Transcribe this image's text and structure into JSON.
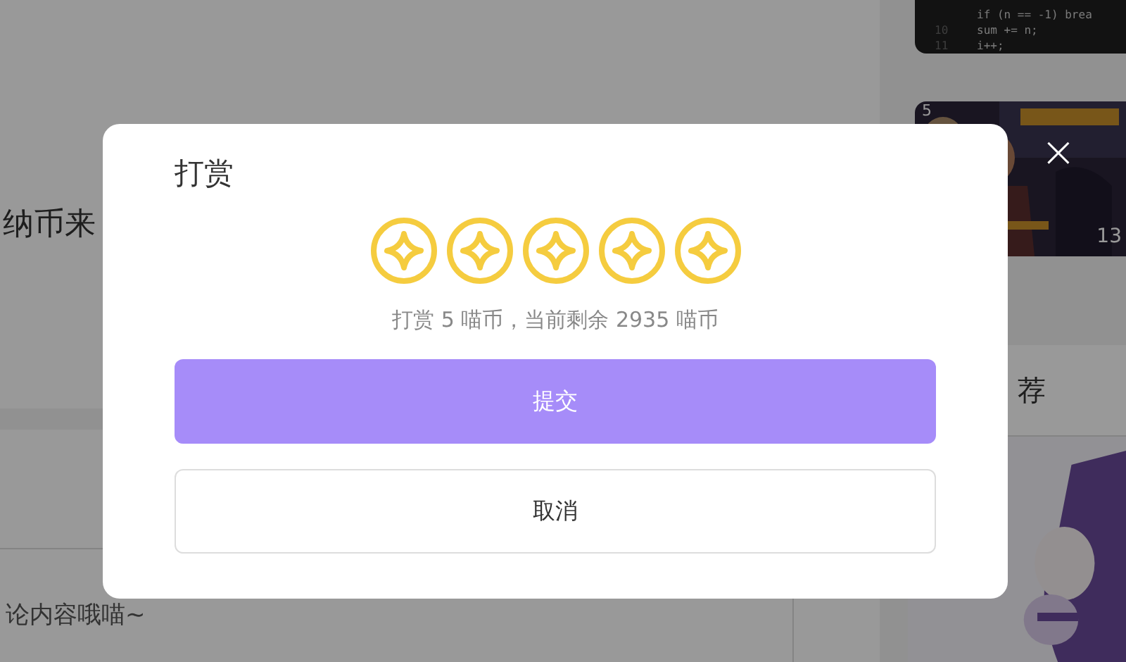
{
  "background": {
    "main_text": "纳币来",
    "comment_hint": "论内容哦喵~",
    "code_top": "if (n == -1) brea",
    "code_lines": [
      {
        "number": "10",
        "code": "sum += n;"
      },
      {
        "number": "11",
        "code": "i++;"
      }
    ],
    "video": {
      "kind": "picture",
      "index": "5",
      "duration": "13"
    },
    "section_title": "荐"
  },
  "dialog": {
    "title": "打赏",
    "coins": [
      {
        "selected": true
      },
      {
        "selected": true
      },
      {
        "selected": true
      },
      {
        "selected": true
      },
      {
        "selected": true
      }
    ],
    "summary": "打赏 5 喵币，当前剩余 2935 喵币",
    "submit": "提交",
    "cancel": "取消",
    "close": "×"
  }
}
